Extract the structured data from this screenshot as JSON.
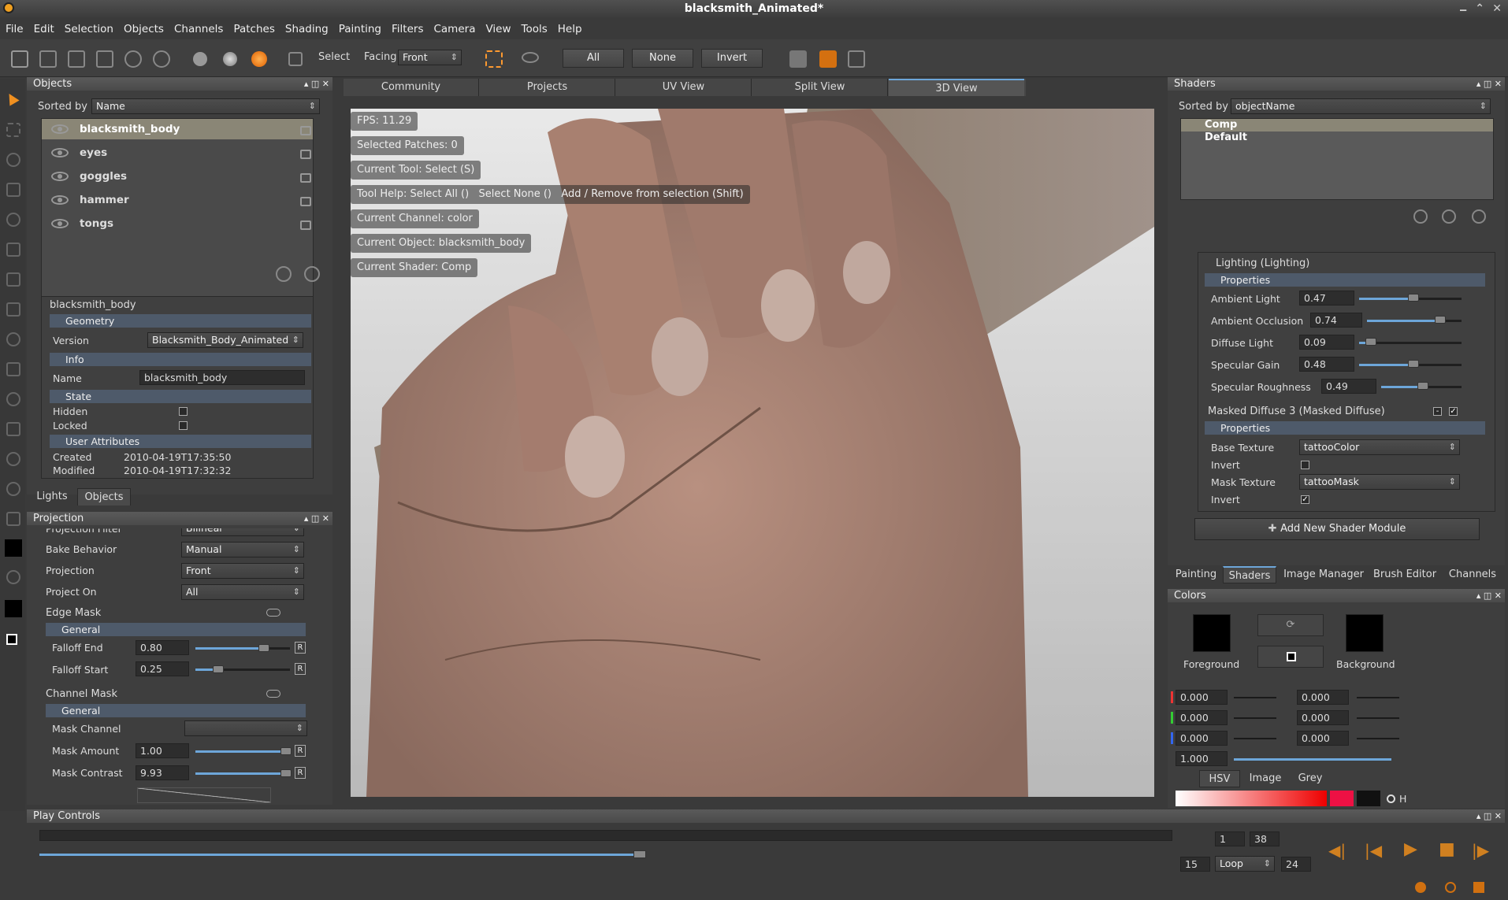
{
  "window": {
    "title": "blacksmith_Animated*"
  },
  "menu": [
    "File",
    "Edit",
    "Selection",
    "Objects",
    "Channels",
    "Patches",
    "Shading",
    "Painting",
    "Filters",
    "Camera",
    "View",
    "Tools",
    "Help"
  ],
  "toolbar": {
    "select_label": "Select",
    "facing_label": "Facing",
    "facing_value": "Front",
    "all": "All",
    "none": "None",
    "invert": "Invert",
    "accent": "#ff8a1c"
  },
  "objects_panel": {
    "title": "Objects",
    "sorted_by_label": "Sorted by",
    "sorted_by_value": "Name",
    "items": [
      {
        "name": "blacksmith_body",
        "selected": true
      },
      {
        "name": "eyes"
      },
      {
        "name": "goggles"
      },
      {
        "name": "hammer"
      },
      {
        "name": "tongs"
      }
    ]
  },
  "properties": {
    "object": "blacksmith_body",
    "geometry": "Geometry",
    "version_label": "Version",
    "version_value": "Blacksmith_Body_Animated",
    "info": "Info",
    "name_label": "Name",
    "name_value": "blacksmith_body",
    "state": "State",
    "hidden_label": "Hidden",
    "locked_label": "Locked",
    "user_attributes": "User Attributes",
    "created_label": "Created",
    "created_value": "2010-04-19T17:35:50",
    "modified_label": "Modified",
    "modified_value": "2010-04-19T17:32:32"
  },
  "left_tabs": [
    "Lights",
    "Objects"
  ],
  "projection": {
    "title": "Projection",
    "filter_label": "Projection Filter",
    "filter_value": "Bilinear",
    "bake_label": "Bake Behavior",
    "bake_value": "Manual",
    "projection_label": "Projection",
    "projection_value": "Front",
    "project_on_label": "Project On",
    "project_on_value": "All",
    "edge_mask": "Edge Mask",
    "general": "General",
    "falloff_end_label": "Falloff End",
    "falloff_end_value": "0.80",
    "falloff_start_label": "Falloff Start",
    "falloff_start_value": "0.25",
    "channel_mask": "Channel Mask",
    "general2": "General",
    "mask_channel_label": "Mask Channel",
    "mask_amount_label": "Mask Amount",
    "mask_amount_value": "1.00",
    "mask_contrast_label": "Mask Contrast",
    "mask_contrast_value": "9.93",
    "r": "R"
  },
  "view_tabs": [
    {
      "label": "Community"
    },
    {
      "label": "Projects"
    },
    {
      "label": "UV View"
    },
    {
      "label": "Split View"
    },
    {
      "label": "3D View",
      "active": true
    }
  ],
  "viewport_info": [
    "FPS: 11.29",
    "Selected Patches: 0",
    "Current Tool: Select (S)",
    "Tool Help: Select All ()   Select None ()   Add / Remove from selection (Shift)",
    "Current Channel: color",
    "Current Object: blacksmith_body",
    "Current Shader: Comp"
  ],
  "shaders_panel": {
    "title": "Shaders",
    "sorted_by_label": "Sorted by",
    "sorted_by_value": "objectName",
    "items": [
      "Comp",
      "Default"
    ],
    "lighting": "Lighting (Lighting)",
    "properties": "Properties",
    "params": [
      {
        "label": "Ambient Light",
        "value": "0.47",
        "level": 0.47
      },
      {
        "label": "Ambient Occlusion",
        "value": "0.74",
        "level": 0.74
      },
      {
        "label": "Diffuse Light",
        "value": "0.09",
        "level": 0.09
      },
      {
        "label": "Specular Gain",
        "value": "0.48",
        "level": 0.48
      },
      {
        "label": "Specular Roughness",
        "value": "0.49",
        "level": 0.49
      }
    ],
    "masked": "Masked Diffuse 3 (Masked Diffuse)",
    "properties2": "Properties",
    "base_texture_label": "Base Texture",
    "base_texture_value": "tattooColor",
    "invert_label": "Invert",
    "mask_texture_label": "Mask Texture",
    "mask_texture_value": "tattooMask",
    "invert2_label": "Invert",
    "add_module": "Add New Shader Module"
  },
  "right_tabs": [
    "Painting",
    "Shaders",
    "Image Manager",
    "Brush Editor",
    "Channels"
  ],
  "colors_panel": {
    "title": "Colors",
    "foreground": "Foreground",
    "background": "Background",
    "fg_color": "#000000",
    "bg_color": "#000000",
    "left_values": [
      "0.000",
      "0.000",
      "0.000",
      "1.000"
    ],
    "right_values": [
      "0.000",
      "0.000",
      "0.000"
    ],
    "tabs": [
      "HSV",
      "Image",
      "Grey"
    ],
    "h_label": "H"
  },
  "play_controls": {
    "title": "Play Controls",
    "start": "1",
    "end": "38",
    "current": "15",
    "mode": "Loop",
    "fps": "24",
    "progress": 0.53
  }
}
